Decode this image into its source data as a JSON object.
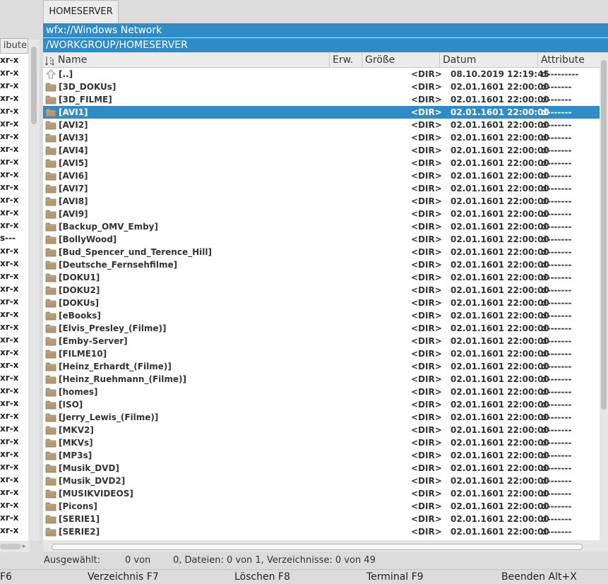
{
  "tab": {
    "label": "HOMESERVER"
  },
  "path": {
    "network": "wfx://Windows Network",
    "current": "/WORKGROUP/HOMESERVER"
  },
  "left_panel": {
    "header": "ibute",
    "rows": [
      "xr-x",
      "xr-x",
      "xr-x",
      "xr-x",
      "xr-x",
      "xr-x",
      "xr-x",
      "xr-x",
      "xr-x",
      "xr-x",
      "xr-x",
      "xr-x",
      "xr-x",
      "xr-x",
      "s---",
      "xr-x",
      "xr-x",
      "xr-x",
      "xr-x",
      "xr-x",
      "xr-x",
      "xr-x",
      "xr-x",
      "xr-x",
      "xr-x",
      "xr-x",
      "xr-x",
      "xr-x",
      "xr-x",
      "xr-x",
      "xr-x",
      "xr-x",
      "xr-x",
      "xr-x",
      "xr-x",
      "xr-x",
      "xr-x",
      "xr-x"
    ]
  },
  "columns": {
    "name": "Name",
    "ext": "Erw.",
    "size": "Größe",
    "date": "Datum",
    "attr": "Attribute"
  },
  "rows": [
    {
      "name": "[..]",
      "size": "<DIR>",
      "date": "08.10.2019 12:19:45",
      "attr": "d---------",
      "icon": "up-arrow-icon"
    },
    {
      "name": "[3D_DOKUs]",
      "size": "<DIR>",
      "date": "02.01.1601 22:00:00",
      "attr": "d-------",
      "icon": "folder-icon"
    },
    {
      "name": "[3D_FILME]",
      "size": "<DIR>",
      "date": "02.01.1601 22:00:00",
      "attr": "d-------",
      "icon": "folder-icon"
    },
    {
      "name": "[AVI1]",
      "size": "<DIR>",
      "date": "02.01.1601 22:00:00",
      "attr": "d-------",
      "icon": "folder-icon",
      "selected": true
    },
    {
      "name": "[AVI2]",
      "size": "<DIR>",
      "date": "02.01.1601 22:00:00",
      "attr": "d-------",
      "icon": "folder-icon"
    },
    {
      "name": "[AVI3]",
      "size": "<DIR>",
      "date": "02.01.1601 22:00:00",
      "attr": "d-------",
      "icon": "folder-icon"
    },
    {
      "name": "[AVI4]",
      "size": "<DIR>",
      "date": "02.01.1601 22:00:00",
      "attr": "d-------",
      "icon": "folder-icon"
    },
    {
      "name": "[AVI5]",
      "size": "<DIR>",
      "date": "02.01.1601 22:00:00",
      "attr": "d-------",
      "icon": "folder-icon"
    },
    {
      "name": "[AVI6]",
      "size": "<DIR>",
      "date": "02.01.1601 22:00:00",
      "attr": "d-------",
      "icon": "folder-icon"
    },
    {
      "name": "[AVI7]",
      "size": "<DIR>",
      "date": "02.01.1601 22:00:00",
      "attr": "d-------",
      "icon": "folder-icon"
    },
    {
      "name": "[AVI8]",
      "size": "<DIR>",
      "date": "02.01.1601 22:00:00",
      "attr": "d-------",
      "icon": "folder-icon"
    },
    {
      "name": "[AVI9]",
      "size": "<DIR>",
      "date": "02.01.1601 22:00:00",
      "attr": "d-------",
      "icon": "folder-icon"
    },
    {
      "name": "[Backup_OMV_Emby]",
      "size": "<DIR>",
      "date": "02.01.1601 22:00:00",
      "attr": "d-------",
      "icon": "folder-icon"
    },
    {
      "name": "[BollyWood]",
      "size": "<DIR>",
      "date": "02.01.1601 22:00:00",
      "attr": "d-------",
      "icon": "folder-icon"
    },
    {
      "name": "[Bud_Spencer_und_Terence_Hill]",
      "size": "<DIR>",
      "date": "02.01.1601 22:00:00",
      "attr": "d-------",
      "icon": "folder-icon"
    },
    {
      "name": "[Deutsche_Fernsehfilme]",
      "size": "<DIR>",
      "date": "02.01.1601 22:00:00",
      "attr": "d-------",
      "icon": "folder-icon"
    },
    {
      "name": "[DOKU1]",
      "size": "<DIR>",
      "date": "02.01.1601 22:00:00",
      "attr": "d-------",
      "icon": "folder-icon"
    },
    {
      "name": "[DOKU2]",
      "size": "<DIR>",
      "date": "02.01.1601 22:00:00",
      "attr": "d-------",
      "icon": "folder-icon"
    },
    {
      "name": "[DOKUs]",
      "size": "<DIR>",
      "date": "02.01.1601 22:00:00",
      "attr": "d-------",
      "icon": "folder-icon"
    },
    {
      "name": "[eBooks]",
      "size": "<DIR>",
      "date": "02.01.1601 22:00:00",
      "attr": "d-------",
      "icon": "folder-icon"
    },
    {
      "name": "[Elvis_Presley_(Filme)]",
      "size": "<DIR>",
      "date": "02.01.1601 22:00:00",
      "attr": "d-------",
      "icon": "folder-icon"
    },
    {
      "name": "[Emby-Server]",
      "size": "<DIR>",
      "date": "02.01.1601 22:00:00",
      "attr": "d-------",
      "icon": "folder-icon"
    },
    {
      "name": "[FILME10]",
      "size": "<DIR>",
      "date": "02.01.1601 22:00:00",
      "attr": "d-------",
      "icon": "folder-icon"
    },
    {
      "name": "[Heinz_Erhardt_(Filme)]",
      "size": "<DIR>",
      "date": "02.01.1601 22:00:00",
      "attr": "d-------",
      "icon": "folder-icon"
    },
    {
      "name": "[Heinz_Ruehmann_(Filme)]",
      "size": "<DIR>",
      "date": "02.01.1601 22:00:00",
      "attr": "d-------",
      "icon": "folder-icon"
    },
    {
      "name": "[homes]",
      "size": "<DIR>",
      "date": "02.01.1601 22:00:00",
      "attr": "d-------",
      "icon": "folder-icon"
    },
    {
      "name": "[ISO]",
      "size": "<DIR>",
      "date": "02.01.1601 22:00:00",
      "attr": "d-------",
      "icon": "folder-icon"
    },
    {
      "name": "[Jerry_Lewis_(Filme)]",
      "size": "<DIR>",
      "date": "02.01.1601 22:00:00",
      "attr": "d-------",
      "icon": "folder-icon"
    },
    {
      "name": "[MKV2]",
      "size": "<DIR>",
      "date": "02.01.1601 22:00:00",
      "attr": "d-------",
      "icon": "folder-icon"
    },
    {
      "name": "[MKVs]",
      "size": "<DIR>",
      "date": "02.01.1601 22:00:00",
      "attr": "d-------",
      "icon": "folder-icon"
    },
    {
      "name": "[MP3s]",
      "size": "<DIR>",
      "date": "02.01.1601 22:00:00",
      "attr": "d-------",
      "icon": "folder-icon"
    },
    {
      "name": "[Musik_DVD]",
      "size": "<DIR>",
      "date": "02.01.1601 22:00:00",
      "attr": "d-------",
      "icon": "folder-icon"
    },
    {
      "name": "[Musik_DVD2]",
      "size": "<DIR>",
      "date": "02.01.1601 22:00:00",
      "attr": "d-------",
      "icon": "folder-icon"
    },
    {
      "name": "[MUSIKVIDEOS]",
      "size": "<DIR>",
      "date": "02.01.1601 22:00:00",
      "attr": "d-------",
      "icon": "folder-icon"
    },
    {
      "name": "[Picons]",
      "size": "<DIR>",
      "date": "02.01.1601 22:00:00",
      "attr": "d-------",
      "icon": "folder-icon"
    },
    {
      "name": "[SERIE1]",
      "size": "<DIR>",
      "date": "02.01.1601 22:00:00",
      "attr": "d-------",
      "icon": "folder-icon"
    },
    {
      "name": "[SERIE2]",
      "size": "<DIR>",
      "date": "02.01.1601 22:00:00",
      "attr": "d-------",
      "icon": "folder-icon"
    }
  ],
  "status": {
    "label": "Ausgewählt:",
    "von": "0 von",
    "detail": "0, Dateien: 0 von 1, Verzeichnisse: 0 von 49"
  },
  "function_keys": [
    "F6",
    "Verzeichnis F7",
    "Löschen F8",
    "Terminal F9",
    "Beenden Alt+X"
  ],
  "colors": {
    "selection": "#308cc6",
    "folder": "#b39a74",
    "background": "#dcdcdc"
  }
}
